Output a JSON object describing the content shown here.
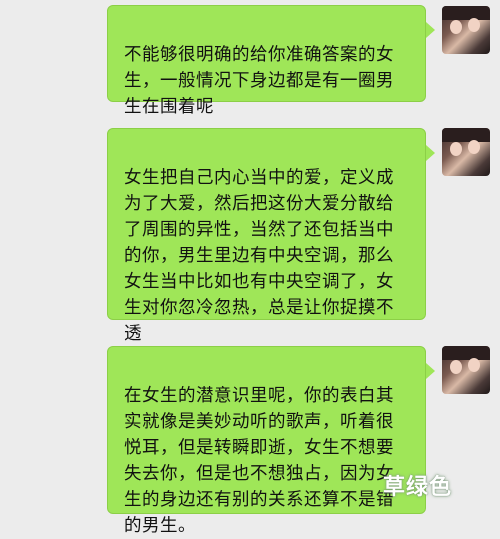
{
  "messages": [
    {
      "text": "不能够很明确的给你准确答案的女\n生，一般情况下身边都是有一圈男\n生在围着呢",
      "sender_avatar": "avatar-photo-icon"
    },
    {
      "text": "女生把自己内心当中的爱，定义成\n为了大爱，然后把这份大爱分散给\n了周围的异性，当然了还包括当中\n的你，男生里边有中央空调，那么\n女生当中比如也有中央空调了，女\n生对你忽冷忽热，总是让你捉摸不\n透",
      "sender_avatar": "avatar-photo-icon"
    },
    {
      "text": "在女生的潜意识里呢，你的表白其\n实就像是美妙动听的歌声，听着很\n悦耳，但是转瞬即逝，女生不想要\n失去你，但是也不想独占，因为女\n生的身边还有别的关系还算不是错\n的男生。",
      "sender_avatar": "avatar-photo-icon"
    }
  ],
  "watermark": "草绿色",
  "colors": {
    "background": "#ececec",
    "bubble": "#9fe658"
  }
}
